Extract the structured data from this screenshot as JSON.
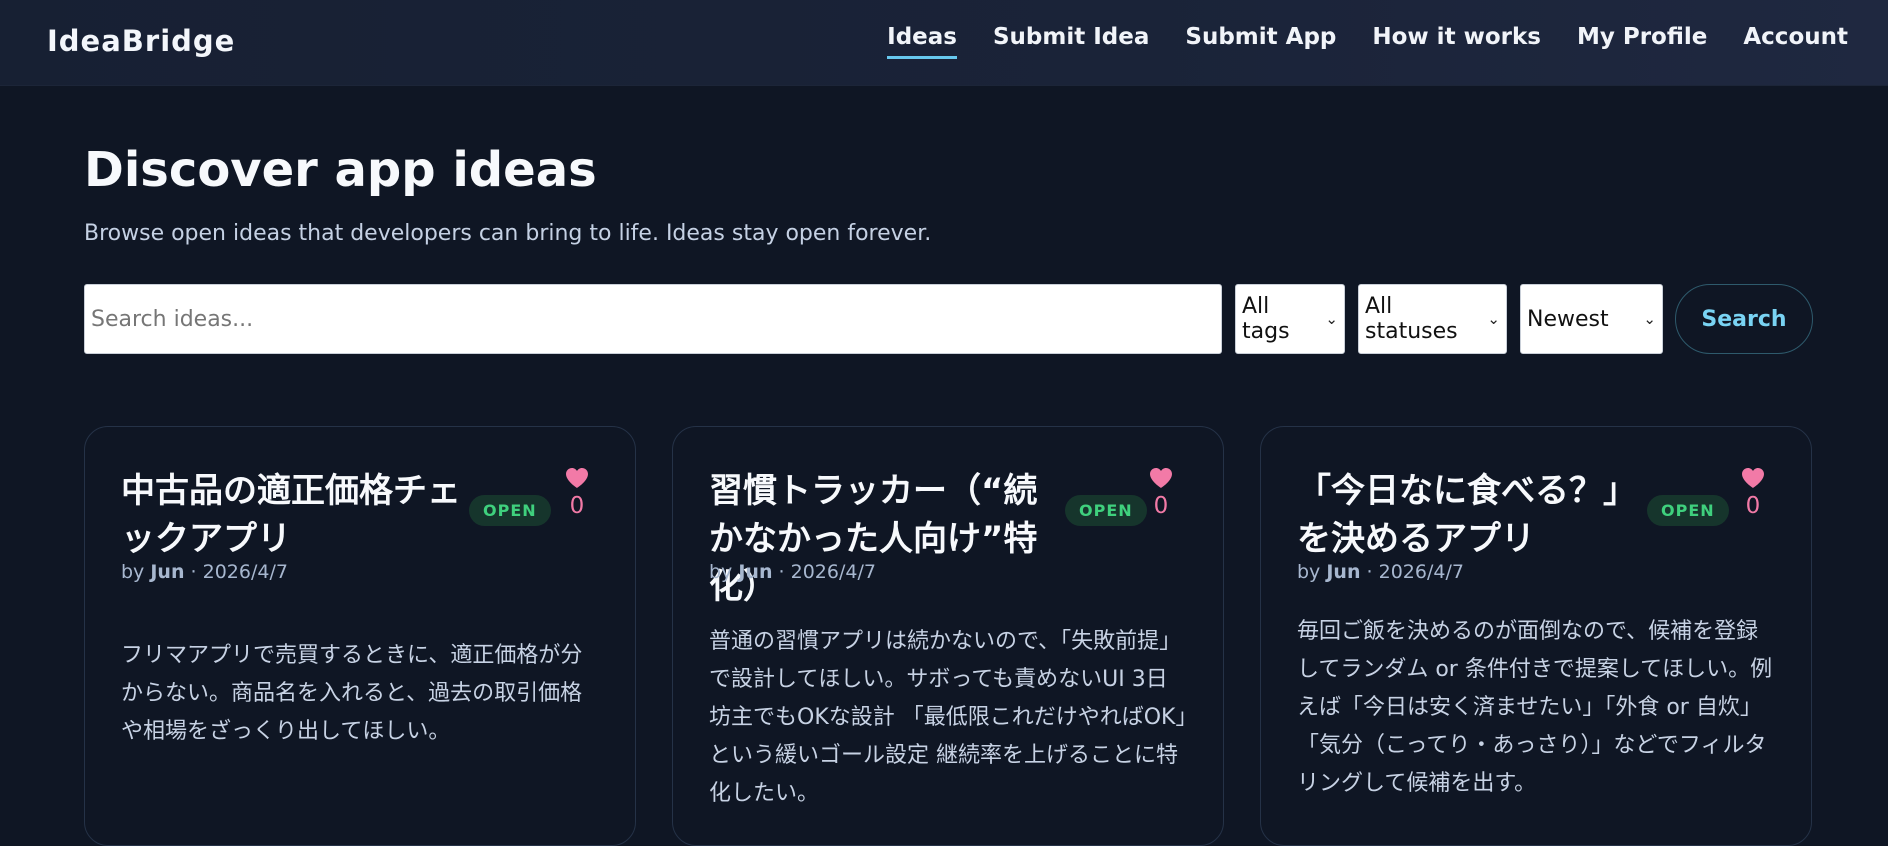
{
  "app": {
    "brand": "IdeaBridge"
  },
  "nav": {
    "items": [
      {
        "label": "Ideas",
        "active": true
      },
      {
        "label": "Submit Idea"
      },
      {
        "label": "Submit App"
      },
      {
        "label": "How it works"
      },
      {
        "label": "My Profile"
      },
      {
        "label": "Account"
      }
    ]
  },
  "hero": {
    "title": "Discover app ideas",
    "subtitle": "Browse open ideas that developers can bring to life. Ideas stay open forever."
  },
  "filters": {
    "search_placeholder": "Search ideas...",
    "search_value": "",
    "tags_selected": "All tags",
    "status_selected": "All statuses",
    "sort_selected": "Newest",
    "search_button": "Search"
  },
  "cards": [
    {
      "title": "中古品の適正価格チェックアプリ",
      "status": "OPEN",
      "likes": "0",
      "by_prefix": "by",
      "author": "Jun",
      "date": "· 2026/4/7",
      "description": "フリマアプリで売買するときに、適正価格が分からない。商品名を入れると、過去の取引価格や相場をざっくり出してほしい。"
    },
    {
      "title": "習慣トラッカー（“続かなかった人向け”特化）",
      "status": "OPEN",
      "likes": "0",
      "by_prefix": "by",
      "author": "Jun",
      "date": "· 2026/4/7",
      "description": "普通の習慣アプリは続かないので、「失敗前提」で設計してほしい。サボっても責めないUI 3日坊主でもOKな設計 「最低限これだけやればOK」という緩いゴール設定 継続率を上げることに特化したい。"
    },
    {
      "title": "「今日なに食べる？」を決めるアプリ",
      "status": "OPEN",
      "likes": "0",
      "by_prefix": "by",
      "author": "Jun",
      "date": "· 2026/4/7",
      "description": "毎回ご飯を決めるのが面倒なので、候補を登録してランダム or 条件付きで提案してほしい。例えば「今日は安く済ませたい」「外食 or 自炊」「気分（こってり・あっさり）」などでフィルタリングして候補を出す。"
    }
  ],
  "colors": {
    "background": "#0f1624",
    "accent": "#67c8ee",
    "open_badge": "#3fd07d",
    "heart": "#f27aa7"
  },
  "icons": {
    "like": "heart-icon",
    "dropdown": "chevron-down-icon"
  }
}
